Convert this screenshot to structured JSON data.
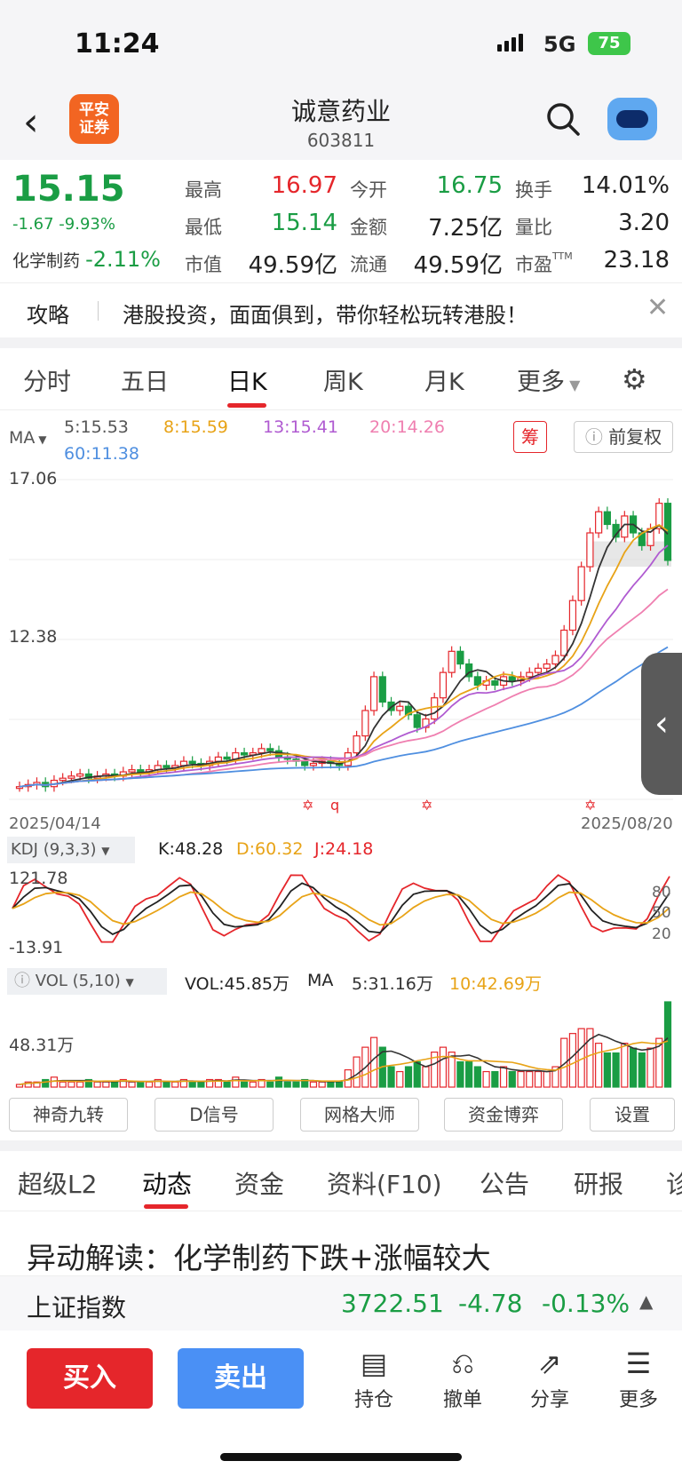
{
  "status": {
    "time": "11:24",
    "network": "5G",
    "battery": "75"
  },
  "header": {
    "broker_logo": "平安\n证券",
    "name": "诚意药业",
    "code": "603811"
  },
  "quote": {
    "price": "15.15",
    "change": "-1.67 -9.93%",
    "sector_name": "化学制药",
    "sector_change": "-2.11%",
    "stats": [
      {
        "label": "最高",
        "value": "16.97",
        "color": "red"
      },
      {
        "label": "今开",
        "value": "16.75",
        "color": "grn"
      },
      {
        "label": "换手",
        "value": "14.01%",
        "color": "blk"
      },
      {
        "label": "最低",
        "value": "15.14",
        "color": "grn"
      },
      {
        "label": "金额",
        "value": "7.25亿",
        "color": "blk"
      },
      {
        "label": "量比",
        "value": "3.20",
        "color": "blk"
      },
      {
        "label": "市值",
        "value": "49.59亿",
        "color": "blk"
      },
      {
        "label": "流通",
        "value": "49.59亿",
        "color": "blk"
      },
      {
        "label": "市盈",
        "value": "23.18",
        "color": "blk",
        "sup": "TTM"
      }
    ]
  },
  "banner": {
    "tag": "攻略",
    "text": "港股投资，面面俱到，带你轻松玩转港股！"
  },
  "chart_tabs": [
    "分时",
    "五日",
    "日K",
    "周K",
    "月K",
    "更多"
  ],
  "chart": {
    "ma_label": "MA",
    "ma_values": [
      {
        "t": "5:15.53",
        "c": "#555"
      },
      {
        "t": "8:15.59",
        "c": "#e8a317"
      },
      {
        "t": "13:15.41",
        "c": "#b05bd1"
      },
      {
        "t": "20:14.26",
        "c": "#ef7fb0"
      },
      {
        "t": "60:11.38",
        "c": "#4f8fe0"
      }
    ],
    "chou": "筹",
    "fuquan": "前复权",
    "y_high": "17.06",
    "y_mid": "12.38",
    "date_start": "2025/04/14",
    "date_end": "2025/08/20",
    "kdj_label": "KDJ (9,3,3)",
    "kdj_k": "K:48.28",
    "kdj_d": "D:60.32",
    "kdj_j": "J:24.18",
    "kdj_top": "121.78",
    "kdj_bottom": "-13.91",
    "kdj_levels": [
      "80",
      "50",
      "20"
    ],
    "vol_label": "VOL (5,10)",
    "vol_value": "VOL:45.85万",
    "vol_ma": "MA",
    "vol_ma5": "5:31.16万",
    "vol_ma10": "10:42.69万",
    "vol_axis": "48.31万"
  },
  "chart_data": {
    "type": "candlestick",
    "x_start": "2025/04/14",
    "x_end": "2025/08/20",
    "ylim": [
      9.5,
      17.06
    ],
    "close": [
      9.8,
      9.85,
      9.9,
      9.8,
      9.95,
      10.0,
      10.05,
      10.1,
      10.0,
      10.05,
      10.1,
      10.05,
      10.15,
      10.2,
      10.15,
      10.2,
      10.3,
      10.25,
      10.3,
      10.4,
      10.35,
      10.3,
      10.4,
      10.5,
      10.45,
      10.6,
      10.55,
      10.6,
      10.7,
      10.65,
      10.5,
      10.45,
      10.4,
      10.3,
      10.35,
      10.4,
      10.35,
      10.3,
      10.6,
      11.0,
      11.6,
      12.4,
      11.8,
      11.6,
      11.7,
      11.5,
      11.2,
      11.4,
      11.9,
      12.5,
      13.0,
      12.7,
      12.4,
      12.2,
      12.3,
      12.2,
      12.4,
      12.3,
      12.4,
      12.5,
      12.6,
      12.7,
      12.9,
      13.5,
      14.2,
      15.0,
      15.8,
      16.3,
      16.0,
      15.7,
      16.2,
      15.8,
      15.5,
      15.9,
      16.5,
      15.15
    ]
  },
  "chips": [
    "神奇九转",
    "D信号",
    "网格大师",
    "资金博弈",
    "设置"
  ],
  "bottom_tabs": [
    "超级L2",
    "动态",
    "资金",
    "资料(F10)",
    "公告",
    "研报",
    "诊"
  ],
  "news_title": "异动解读：化学制药下跌+涨幅较大",
  "index": {
    "name": "上证指数",
    "value": "3722.51",
    "change": "-4.78",
    "pct": "-0.13%"
  },
  "footer": {
    "buy": "买入",
    "sell": "卖出",
    "items": [
      {
        "icon": "holdings-icon",
        "label": "持仓"
      },
      {
        "icon": "cancel-order-icon",
        "label": "撤单"
      },
      {
        "icon": "share-icon",
        "label": "分享"
      },
      {
        "icon": "more-icon",
        "label": "更多"
      }
    ]
  }
}
